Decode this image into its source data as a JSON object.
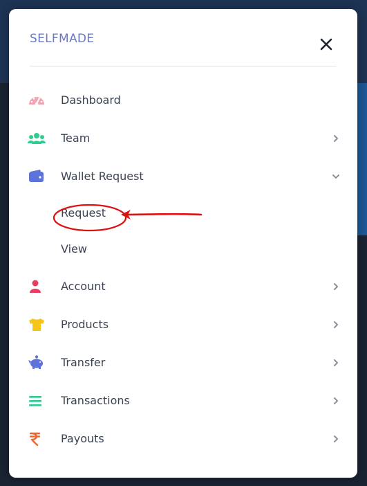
{
  "brand": "SELFMADE",
  "menu": {
    "dashboard": "Dashboard",
    "team": "Team",
    "wallet_request": "Wallet Request",
    "wallet_sub": {
      "request": "Request",
      "view": "View"
    },
    "account": "Account",
    "products": "Products",
    "transfer": "Transfer",
    "transactions": "Transactions",
    "payouts": "Payouts"
  },
  "icons": {
    "dashboard": "speedometer-icon",
    "team": "users-icon",
    "wallet": "wallet-icon",
    "account": "user-icon",
    "products": "tshirt-icon",
    "transfer": "piggy-bank-icon",
    "transactions": "list-icon",
    "payouts": "rupee-icon",
    "close": "close-icon"
  },
  "colors": {
    "brand": "#6a78c9",
    "dashboard": "#f3a3b1",
    "team": "#2ecc8f",
    "wallet": "#5e73d9",
    "account": "#e63e62",
    "products": "#f5c518",
    "transfer": "#5e73d9",
    "transactions": "#2ecc8f",
    "payouts": "#f06630",
    "annotation": "#dd1111"
  }
}
